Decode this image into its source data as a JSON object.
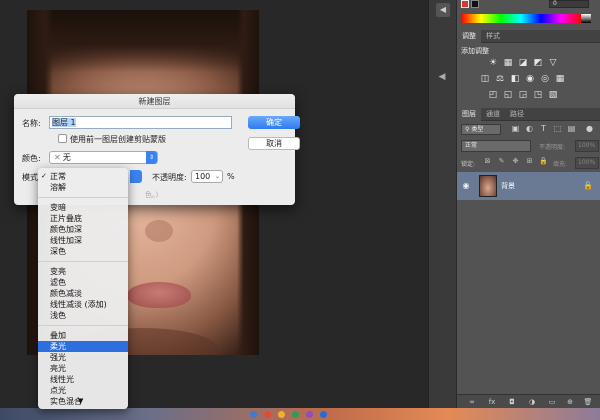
{
  "dialog": {
    "title": "新建图层",
    "name_label": "名称:",
    "name_value": "图层 1",
    "clip_label": "使用前一图层创建剪贴蒙版",
    "color_label": "颜色:",
    "color_value": "无",
    "color_x": "✕",
    "mode_label": "模式",
    "opacity_label": "不透明度:",
    "opacity_value": "100",
    "percent": "%",
    "hint": "色。)",
    "ok": "确定",
    "cancel": "取消"
  },
  "mode_menu": {
    "check": "✓",
    "more": "▼",
    "items": [
      "正常",
      "溶解",
      "变暗",
      "正片叠底",
      "颜色加深",
      "线性加深",
      "深色",
      "变亮",
      "滤色",
      "颜色减淡",
      "线性减淡 (添加)",
      "浅色",
      "叠加",
      "柔光",
      "强光",
      "亮光",
      "线性光",
      "点光",
      "实色混合"
    ],
    "selected_index": 13
  },
  "panels": {
    "color_value": "0",
    "adjust_tabs": [
      "调整",
      "样式"
    ],
    "adjust_title": "添加调整",
    "adjust_icons_row1": [
      "☀",
      "▦",
      "◪",
      "◩",
      "▽"
    ],
    "adjust_icons_row2": [
      "◫",
      "⚖",
      "◧",
      "◉",
      "◎",
      "▦"
    ],
    "adjust_icons_row3": [
      "◰",
      "◱",
      "◲",
      "◳",
      "▧"
    ],
    "layer_tabs": [
      "图层",
      "通道",
      "路径"
    ],
    "filter_label": "类型",
    "blend_mode": "正常",
    "opacity_label": "不透明度:",
    "opacity_value": "100%",
    "lock_label": "锁定:",
    "fill_label": "填充:",
    "fill_value": "100%",
    "layer_name": "背景"
  }
}
